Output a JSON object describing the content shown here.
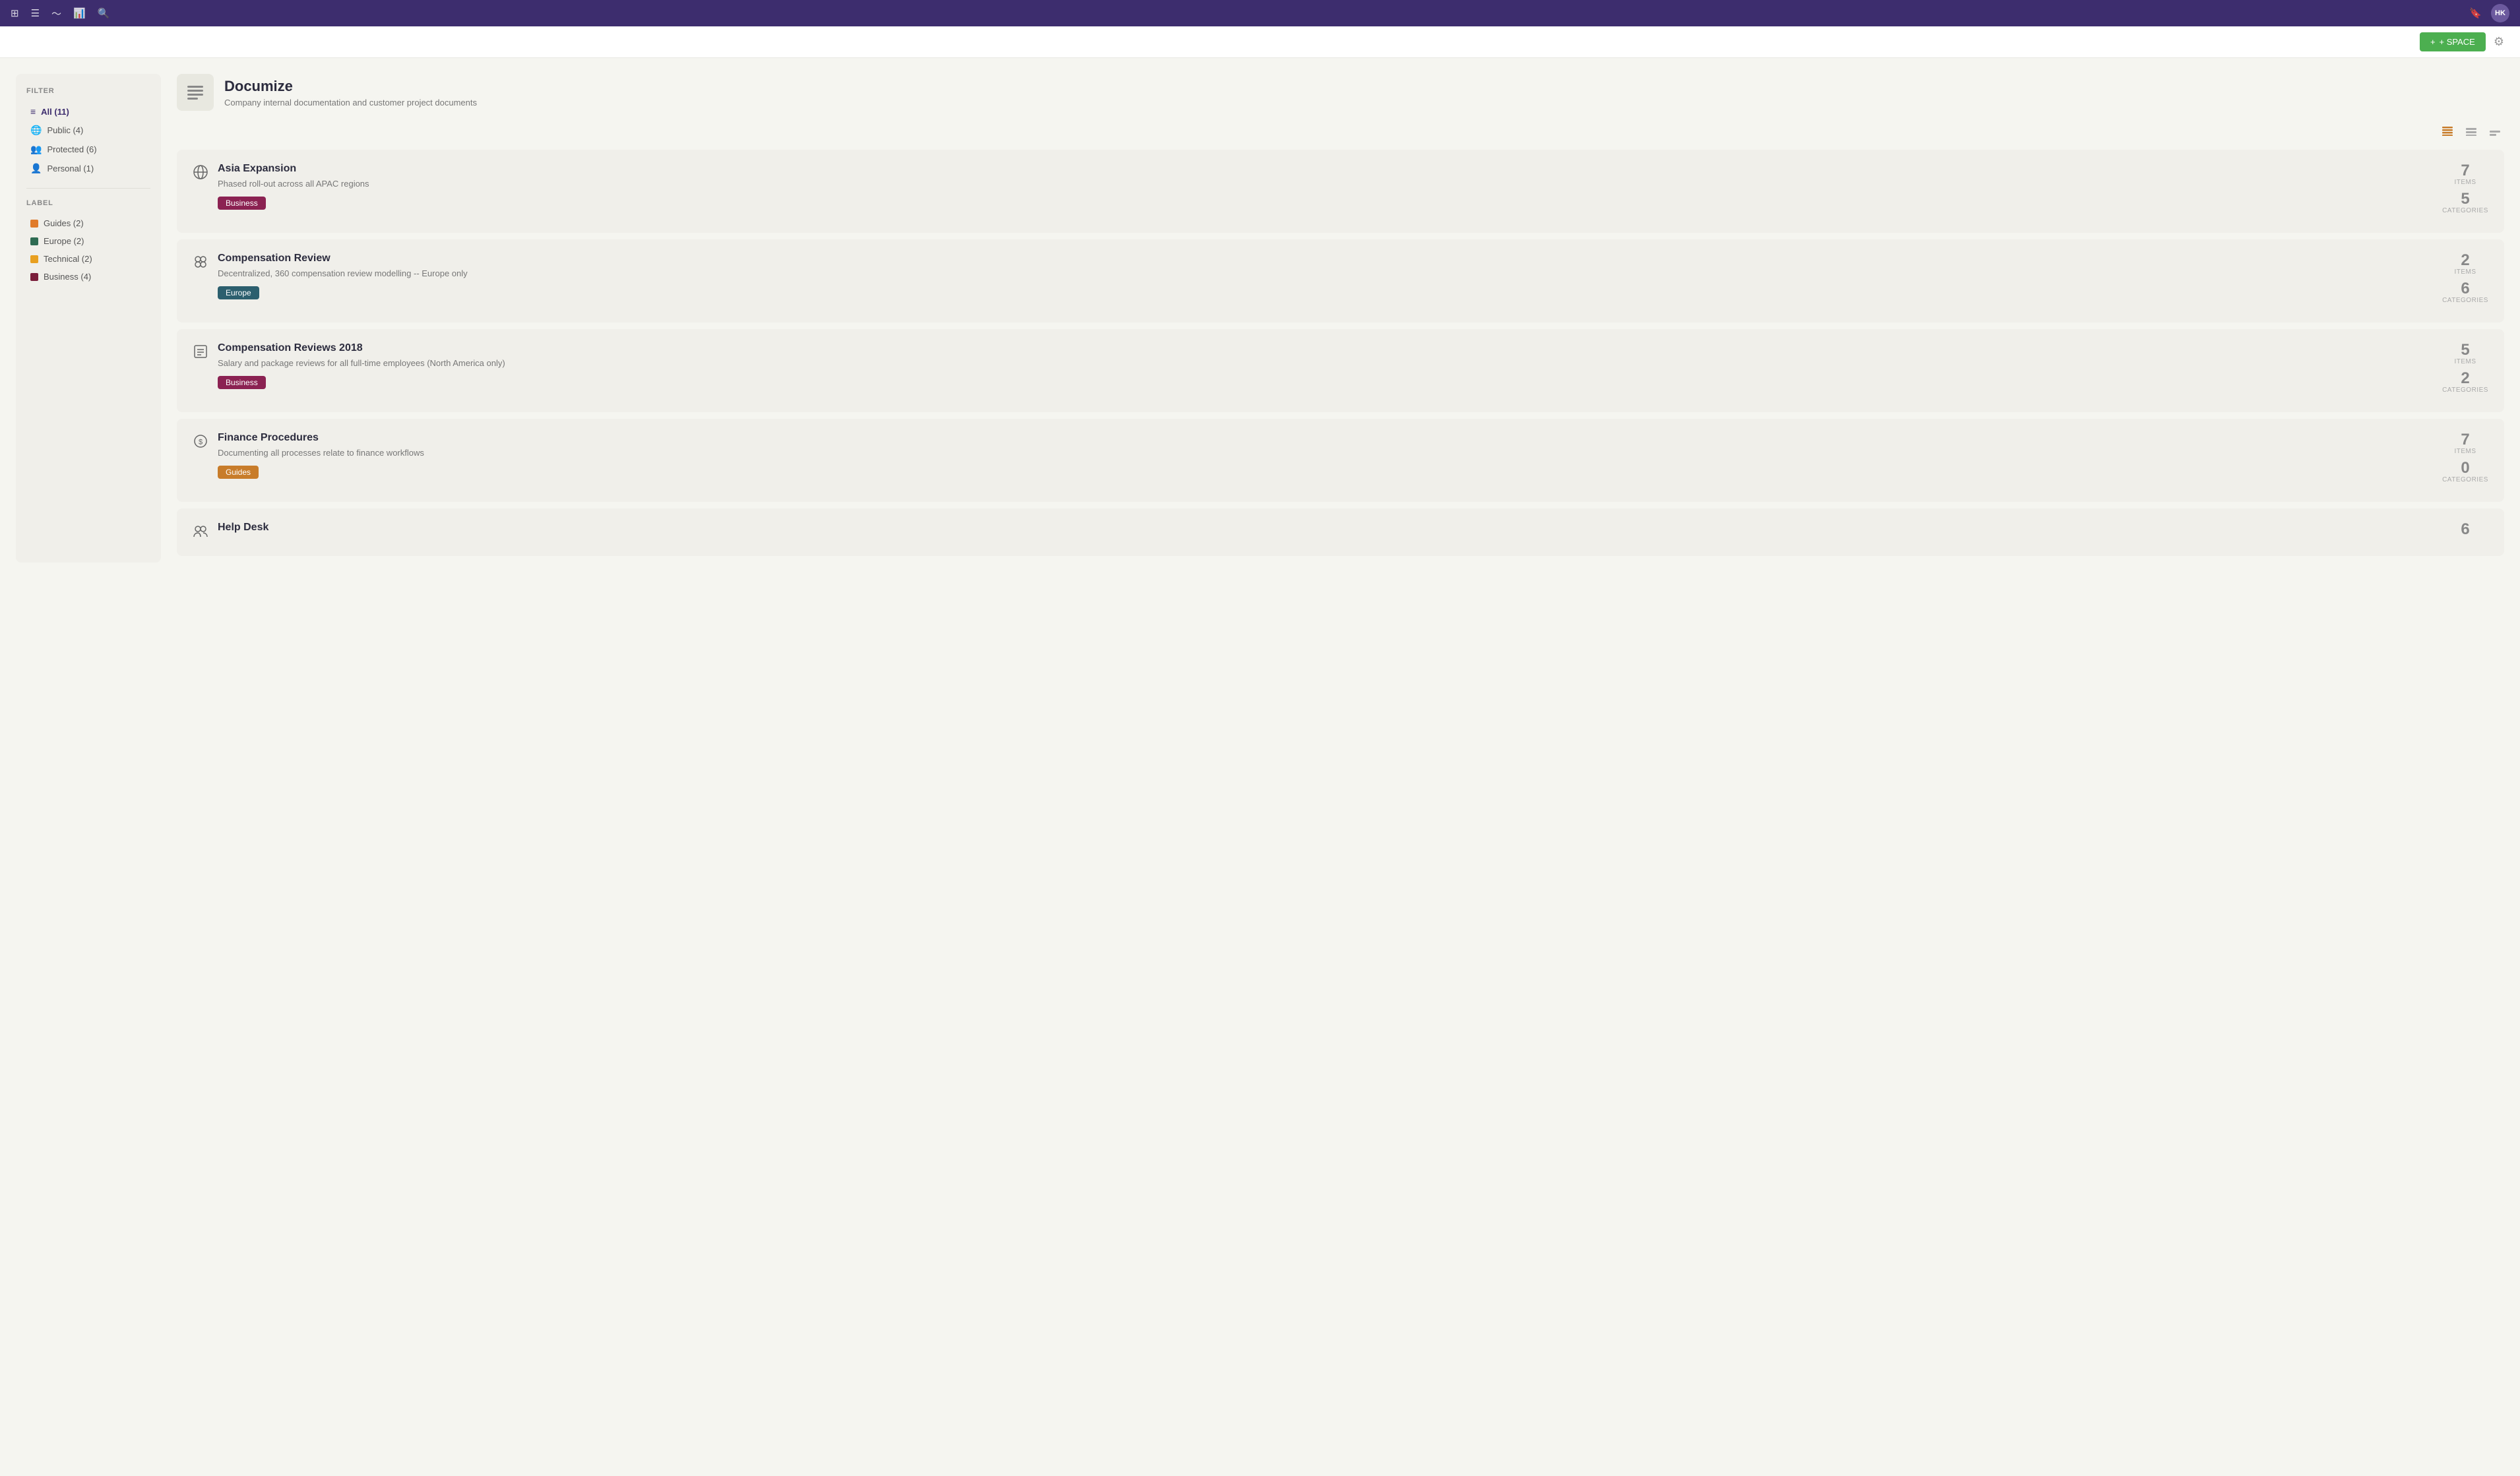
{
  "topnav": {
    "icons": [
      "grid-icon",
      "list-icon",
      "pulse-icon",
      "chart-icon",
      "search-icon"
    ],
    "bookmark_icon": "bookmark-icon",
    "avatar_text": "HK"
  },
  "subheader": {
    "add_space_label": "+ SPACE",
    "settings_icon": "settings-icon"
  },
  "sidebar": {
    "filter_title": "FILTER",
    "filter_items": [
      {
        "label": "All (11)",
        "icon": "≡",
        "active": true
      },
      {
        "label": "Public (4)",
        "icon": "🌐"
      },
      {
        "label": "Protected (6)",
        "icon": "👥"
      },
      {
        "label": "Personal (1)",
        "icon": "👤"
      }
    ],
    "label_title": "LABEL",
    "labels": [
      {
        "name": "Guides (2)",
        "color": "#e07b2a"
      },
      {
        "name": "Europe (2)",
        "color": "#2e6b52"
      },
      {
        "name": "Technical (2)",
        "color": "#e8a020"
      },
      {
        "name": "Business (4)",
        "color": "#7a1e3a"
      }
    ]
  },
  "space": {
    "title": "Documize",
    "description": "Company internal documentation and customer project documents"
  },
  "view_controls": {
    "dense": "≡",
    "normal": "≡",
    "wide": "—"
  },
  "cards": [
    {
      "id": "asia-expansion",
      "title": "Asia Expansion",
      "description": "Phased roll-out across all APAC regions",
      "tag": "Business",
      "tag_class": "tag-business",
      "items": "7",
      "categories": "5",
      "icon": "🌐"
    },
    {
      "id": "compensation-review",
      "title": "Compensation Review",
      "description": "Decentralized, 360 compensation review modelling -- Europe only",
      "tag": "Europe",
      "tag_class": "tag-europe",
      "items": "2",
      "categories": "6",
      "icon": "◎"
    },
    {
      "id": "compensation-reviews-2018",
      "title": "Compensation Reviews 2018",
      "description": "Salary and package reviews for all full-time employees (North America only)",
      "tag": "Business",
      "tag_class": "tag-business",
      "items": "5",
      "categories": "2",
      "icon": "📋"
    },
    {
      "id": "finance-procedures",
      "title": "Finance Procedures",
      "description": "Documenting all processes relate to finance workflows",
      "tag": "Guides",
      "tag_class": "tag-guides",
      "items": "7",
      "categories": "0",
      "icon": "$"
    },
    {
      "id": "help-desk",
      "title": "Help Desk",
      "description": "",
      "tag": "",
      "tag_class": "",
      "items": "6",
      "categories": "",
      "icon": "👥"
    }
  ],
  "labels": {
    "items": "ITEMS",
    "categories": "CATEGORIES"
  }
}
